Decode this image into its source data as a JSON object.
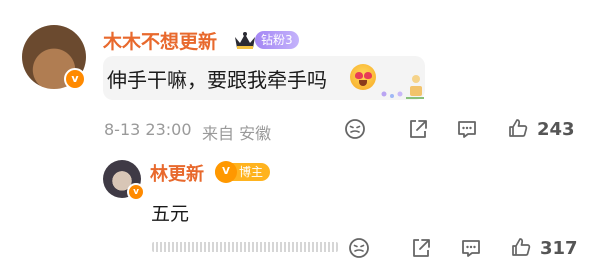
{
  "comment": {
    "username": "木木不想更新",
    "fan_badge": "钻粉3",
    "text": "伸手干嘛，要跟我牵手吗",
    "emoji_icon": "heart-eyes-face-emoji",
    "timestamp": "8-13 23:00",
    "source": "来自 安徽",
    "like_count": "243"
  },
  "reply": {
    "username": "林更新",
    "role_badge": "博主",
    "text": "五元",
    "like_count": "317"
  },
  "colors": {
    "username": "#e8692d",
    "fan_badge": "#a486f4",
    "blogger_badge": "#ffb31f",
    "verified_badge": "#ff8a00"
  },
  "icons": [
    "smile-icon",
    "share-icon",
    "comment-icon",
    "like-icon",
    "crown-icon",
    "verified-badge-icon"
  ]
}
